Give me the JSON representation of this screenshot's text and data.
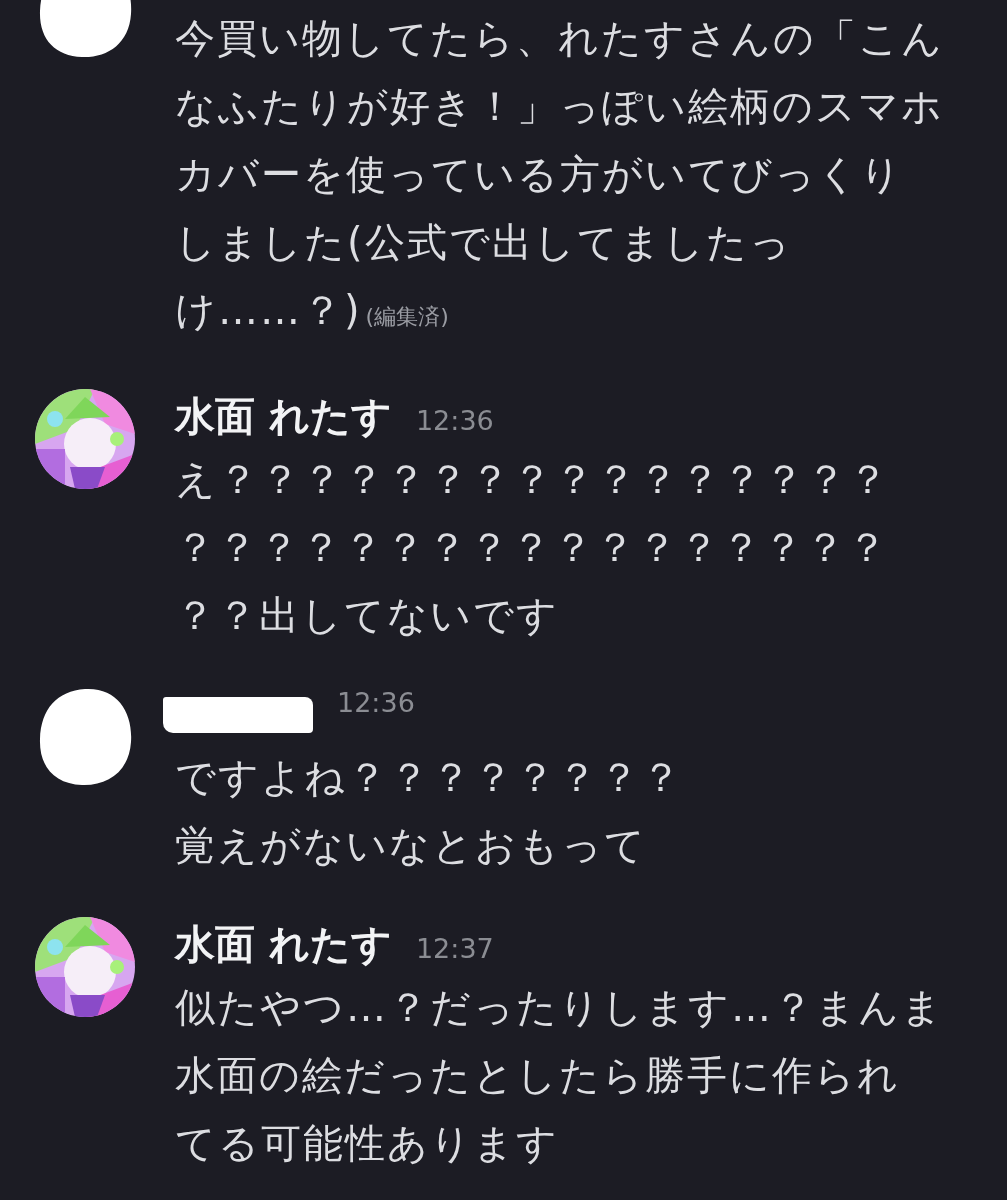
{
  "messages": [
    {
      "avatar": {
        "kind": "redacted"
      },
      "lines": [
        "今買い物してたら、れたすさんの「こん",
        "なふたりが好き！」っぽい絵柄のスマホ",
        "カバーを使っている方がいてびっくり",
        "しました(公式で出してましたっ",
        "け……？)"
      ],
      "edited": "(編集済)"
    },
    {
      "avatar": {
        "kind": "illustrated"
      },
      "author": {
        "name": "水面 れたす",
        "redacted": false
      },
      "time": "12:36",
      "lines": [
        "え？？？？？？？？？？？？？？？？",
        "？？？？？？？？？？？？？？？？？",
        "？？出してないです"
      ]
    },
    {
      "avatar": {
        "kind": "redacted"
      },
      "author": {
        "redacted": true
      },
      "time": "12:36",
      "lines": [
        "ですよね？？？？？？？？",
        "覚えがないなとおもって"
      ]
    },
    {
      "avatar": {
        "kind": "illustrated"
      },
      "author": {
        "name": "水面 れたす",
        "redacted": false
      },
      "time": "12:37",
      "lines": [
        "似たやつ…？だったりします…？まんま",
        "水面の絵だったとしたら勝手に作られ",
        "てる可能性あります"
      ]
    }
  ]
}
